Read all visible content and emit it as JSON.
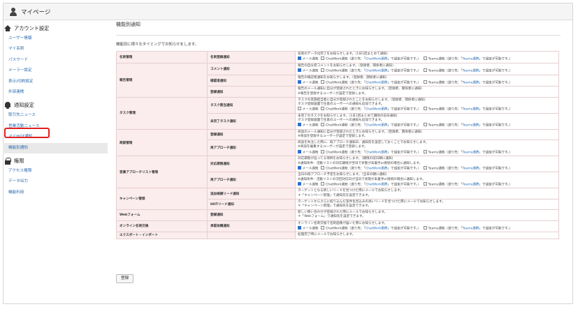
{
  "header": {
    "title": "マイページ"
  },
  "sidebar": {
    "sections": [
      {
        "title": "アカウント設定",
        "icon": "home-icon",
        "items": [
          "ユーザー情報",
          "マイ名刺",
          "パスワード",
          "メーラー設定",
          "表示/印刷設定",
          "外部連携"
        ]
      },
      {
        "title": "通知設定",
        "icon": "bell-icon",
        "items": [
          "取引先ニュース",
          "営業活動ニュース",
          "マイHOT通知",
          "機能別通知"
        ]
      },
      {
        "title": "権限",
        "icon": "lock-icon",
        "items": [
          "アクセス権限",
          "データ出力",
          "機能利用"
        ]
      }
    ],
    "active": "機能別通知"
  },
  "main": {
    "title": "機能別通知",
    "intro": "機能別に様々なタイミングでお知らせをします。",
    "save_label": "登録",
    "opt_mail": "メール通知",
    "opt_chatwork_a": "ChatWork通知（送り先：「",
    "opt_chatwork_link": "ChatWork連携",
    "opt_chatwork_b": "」で設定が可能です。）",
    "opt_teams_a": "Teams通知（送り先：「",
    "opt_teams_link": "Teams連携",
    "opt_teams_b": "」で設定が可能です。）"
  },
  "rows": [
    {
      "cat": "名刺管理",
      "item": "名刺登録通知",
      "desc": [
        "名刺のデータ化完了をお知らせします。（1日1回まとめて通知）"
      ],
      "opts": true,
      "mail_on": true
    },
    {
      "cat": "報告管理",
      "item": "コメント通知",
      "desc": [
        "報告の自分宛コメントをお知らせします。（登録者、関係者に通知）"
      ],
      "opts": true,
      "mail_on": true
    },
    {
      "cat": "",
      "item": "確認者通知",
      "desc": [
        "報告の確認者通知をお知らせします。（登録者、関係者に通知）"
      ],
      "opts": true,
      "mail_on": true
    },
    {
      "cat": "",
      "item": "登録通知",
      "desc": [
        "報告のメール通知に自分が登録されたときにお知らせします。（登録者、関係者に通知）",
        "※報告を登録するユーザーが設定で登録します。"
      ],
      "opts": false
    },
    {
      "cat": "タスク管理",
      "item": "タスク割当通知",
      "desc": [
        "タスクの実施担当者に自分が登録されたことをお知らせします。（登録者、関係者に通知）",
        "タスク登録画面で任意のユーザーへの通知も追加できます。"
      ],
      "opts": true,
      "mail_on": false
    },
    {
      "cat": "",
      "item": "未完了タスク通知",
      "desc": [
        "未完了のタスクをお知らせします。（1日1回まとめて期限の前日通知）",
        "タスク登録画面で任意のユーザーへの通知も追加できます。"
      ],
      "opts": true,
      "mail_on": true
    },
    {
      "cat": "商談管理",
      "item": "登録通知",
      "desc": [
        "商談のメール通知に自分が登録されたときにお知らせします。（登録者、関係者に通知）",
        "※商談を登録するユーザーが設定で登録します。"
      ],
      "opts": false
    },
    {
      "cat": "",
      "item": "再アプローチ通知",
      "desc": [
        "商談を失注した際に、再アプローチ通知日、通知先を設定しておくことでお知らせします。",
        "※商談を編集するユーザーが設定で登録します。"
      ],
      "opts": true,
      "mail_on": true
    },
    {
      "cat": "営業アプローチリスト管理",
      "item": "対応期限通知",
      "desc": [
        "対応期限が迫ってる項目をお知らせします。（期限の前日朝に通知）",
        "※通知条件：活動リストの対応期限が翌日で状態が未着手or接続の場合に通知します。"
      ],
      "opts": true,
      "mail_on": true
    },
    {
      "cat": "",
      "item": "再アプローチ通知",
      "desc": [
        "当日の再アプローチ予定をお知らせします。（当日の朝に通知）",
        "※通知条件：活動リストの次回対応日が当日で状態が未着手or接続の場合に通知します。"
      ],
      "opts": true,
      "mail_on": true
    },
    {
      "cat": "キャンペーン管理",
      "item": "追加候補リード通知",
      "desc": [
        "ターゲットとなる新しいリードを見つけた際にメールでお知らせします。",
        "＊「キャンペーン管理」で通知先を設定できます。"
      ],
      "opts": false
    },
    {
      "cat": "",
      "item": "HOTリード通知",
      "desc": [
        "ターゲットからさらに絞り込んだ案件化見込みの高いリードを見つけた際にメールでお知らせします。",
        "＊「キャンペーン管理」で通知先を設定できます。"
      ],
      "opts": false
    },
    {
      "cat": "Webフォーム",
      "item": "登録通知",
      "desc": [
        "新しい問い合わせが登録された際にメールでお知らせします。",
        "＊「Webフォーム」で通知先を設定できます。"
      ],
      "opts": false
    },
    {
      "cat": "オンライン名刺交換",
      "item": "承認依頼通知",
      "desc": [
        "オンライン名刺交換で名刺画像が届いた際にお知らせします。"
      ],
      "opts": true,
      "mail_on": true
    },
    {
      "cat": "エクスポート・インポート",
      "item": "",
      "desc": [
        "処理完了時にメールでお知らせします。"
      ],
      "opts": false
    }
  ]
}
